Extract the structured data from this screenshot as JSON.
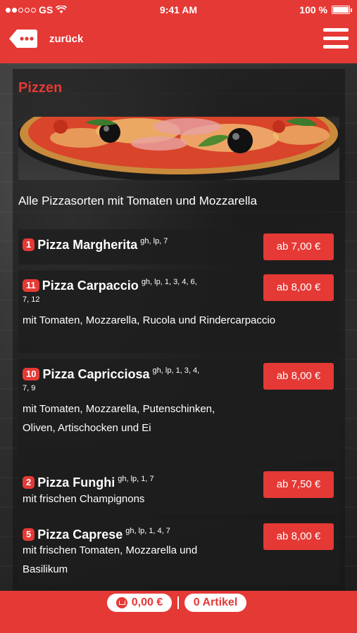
{
  "status_bar": {
    "carrier": "GS",
    "time": "9:41 AM",
    "battery": "100 %"
  },
  "header": {
    "back_label": "zurück"
  },
  "section": {
    "title": "Pizzen",
    "intro": "Alle Pizzasorten mit Tomaten und Mozzarella"
  },
  "items": [
    {
      "number": "1",
      "name": "Pizza Margherita",
      "allergens": "gh, lp, 7",
      "allergens_cont": "",
      "description": "",
      "price": "ab 7,00 €"
    },
    {
      "number": "11",
      "name": "Pizza Carpaccio",
      "allergens": "gh, lp, 1, 3, 4, 6,",
      "allergens_cont": "7, 12",
      "description": "mit Tomaten, Mozzarella, Rucola und Rindercarpaccio",
      "price": "ab 8,00 €"
    },
    {
      "number": "10",
      "name": "Pizza Capricciosa",
      "allergens": "gh, lp, 1, 3, 4,",
      "allergens_cont": "7, 9",
      "description": "mit Tomaten, Mozzarella, Putenschinken, Oliven, Artischocken und Ei",
      "price": "ab 8,00 €"
    },
    {
      "number": "2",
      "name": "Pizza Funghi",
      "allergens": "gh, lp, 1, 7",
      "allergens_cont": "",
      "description": "mit frischen Champignons",
      "price": "ab 7,50 €"
    },
    {
      "number": "5",
      "name": "Pizza Caprese",
      "allergens": "gh, lp, 1, 4, 7",
      "allergens_cont": "",
      "description": "mit frischen Tomaten, Mozzarella und Basilikum",
      "price": "ab 8,00 €"
    }
  ],
  "footer": {
    "cart_total": "0,00 €",
    "item_count": "0 Artikel"
  },
  "colors": {
    "accent": "#e53935"
  }
}
